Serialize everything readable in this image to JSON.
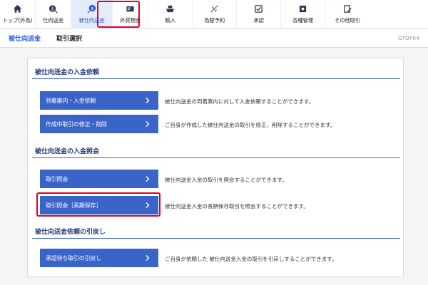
{
  "nav": {
    "items": [
      {
        "label": "トップ(外為)",
        "icon": "home-icon"
      },
      {
        "label": "仕向送金",
        "icon": "dollar-arrow-out-icon"
      },
      {
        "label": "被仕向送金",
        "icon": "dollar-arrow-in-icon"
      },
      {
        "label": "外貨預金",
        "icon": "passbook-icon"
      },
      {
        "label": "輸入",
        "icon": "ship-icon"
      },
      {
        "label": "為替予約",
        "icon": "exchange-contract-icon"
      },
      {
        "label": "承認",
        "icon": "approve-icon"
      },
      {
        "label": "各種管理",
        "icon": "settings-icon"
      },
      {
        "label": "その他取引",
        "icon": "document-edit-icon"
      }
    ]
  },
  "titlebar": {
    "crumb1": "被仕向送金",
    "crumb2": "取引選択",
    "screen_code": "GTOP04"
  },
  "sections": [
    {
      "title": "被仕向送金の入金依頼",
      "buttons": [
        {
          "label": "到着案内・入金依頼",
          "desc": "被仕向送金の到着案内に対して入金依頼することができます。"
        },
        {
          "label": "作成中取引の修正・削除",
          "desc": "ご自身が作成した被仕向送金の取引を修正、削除することができます。"
        }
      ]
    },
    {
      "title": "被仕向送金の入金照会",
      "buttons": [
        {
          "label": "取引照会",
          "desc": "被仕向送金入金の取引を照会することができます。"
        },
        {
          "label": "取引照会［長期保存］",
          "desc": "被仕向送金入金の長期保存取引を照会することができます。"
        }
      ]
    },
    {
      "title": "被仕向送金依頼の引戻し",
      "buttons": [
        {
          "label": "承認待ち取引の引戻し",
          "desc": "ご自身が依頼した 被仕向送金入金の取引を引戻しすることができます。"
        }
      ]
    }
  ],
  "colors": {
    "accent": "#3a64c8",
    "highlight": "#e3002b",
    "section_title": "#233b7b"
  }
}
